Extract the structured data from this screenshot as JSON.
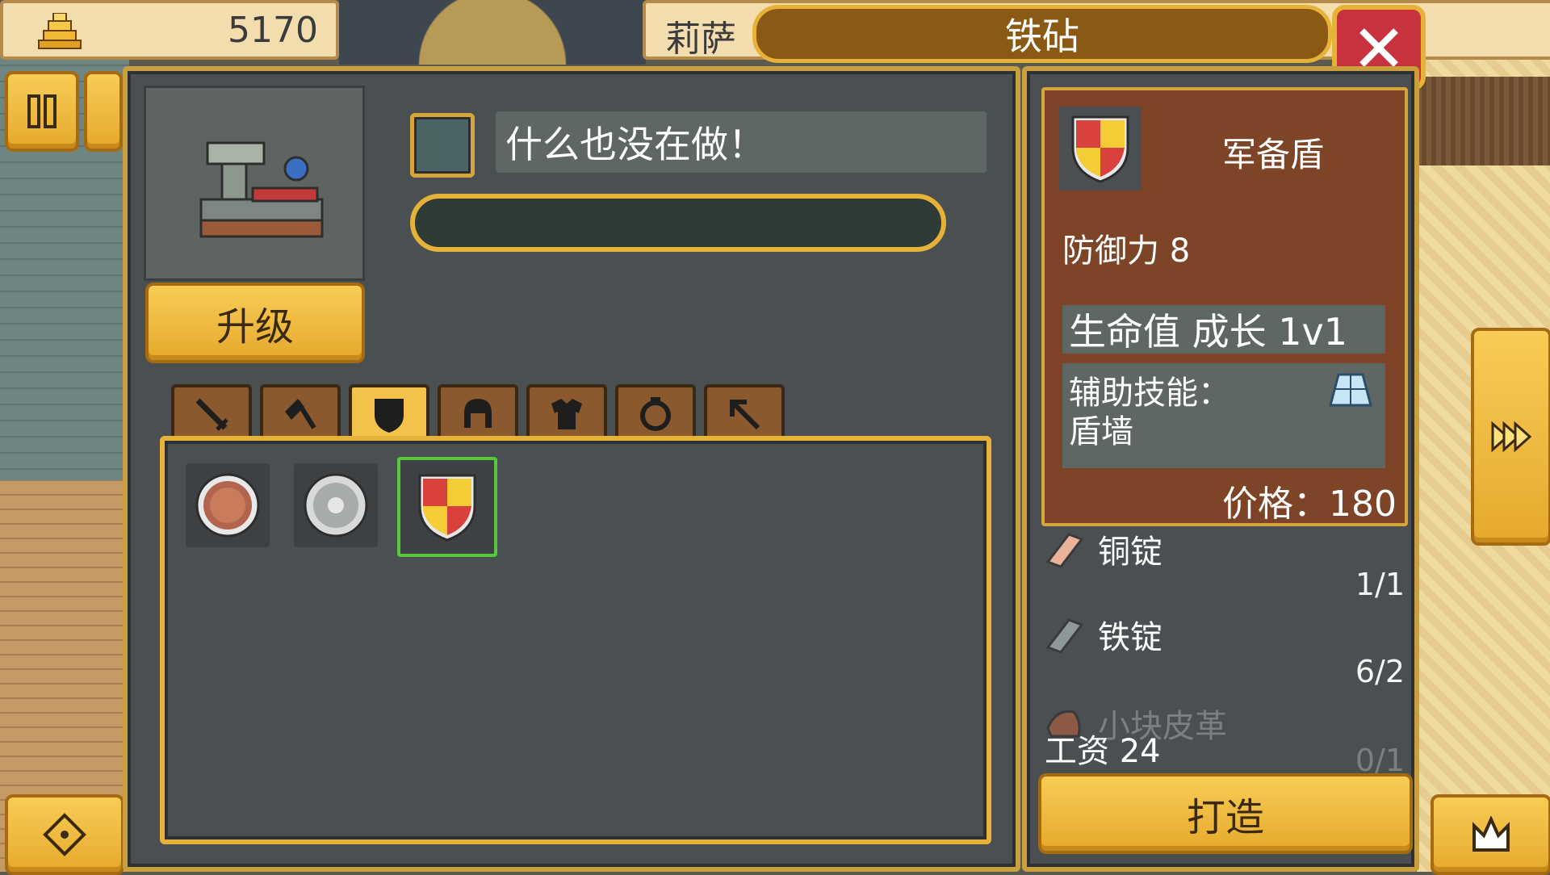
{
  "gold": "5170",
  "npc_name": "莉萨",
  "station_title": "铁砧",
  "status_text": "什么也没在做！",
  "upgrade_label": "升级",
  "tabs": [
    {
      "name": "sword",
      "active": false
    },
    {
      "name": "axe",
      "active": false
    },
    {
      "name": "shield",
      "active": true
    },
    {
      "name": "helmet",
      "active": false
    },
    {
      "name": "armor",
      "active": false
    },
    {
      "name": "ring",
      "active": false
    },
    {
      "name": "bow",
      "active": false
    }
  ],
  "items": [
    {
      "name": "wooden-round-shield",
      "selected": false
    },
    {
      "name": "iron-round-shield",
      "selected": false
    },
    {
      "name": "military-shield",
      "selected": true
    }
  ],
  "detail": {
    "name": "军备盾",
    "stat": "防御力 8",
    "growth": "生命值 成长 1v1",
    "skill_label": "辅助技能：",
    "skill_name": "盾墙",
    "price": "价格：180"
  },
  "materials": [
    {
      "name": "铜锭",
      "count": "1/1",
      "available": true
    },
    {
      "name": "铁锭",
      "count": "6/2",
      "available": true
    },
    {
      "name": "小块皮革",
      "count": "0/1",
      "available": false
    }
  ],
  "wage": "工资 24",
  "craft_label": "打造",
  "colors": {
    "gold": "#e6a92c",
    "panel": "#4a4f52",
    "detail_bg": "#7d4428",
    "selected_border": "#56c83a",
    "close_red": "#c8323e"
  }
}
